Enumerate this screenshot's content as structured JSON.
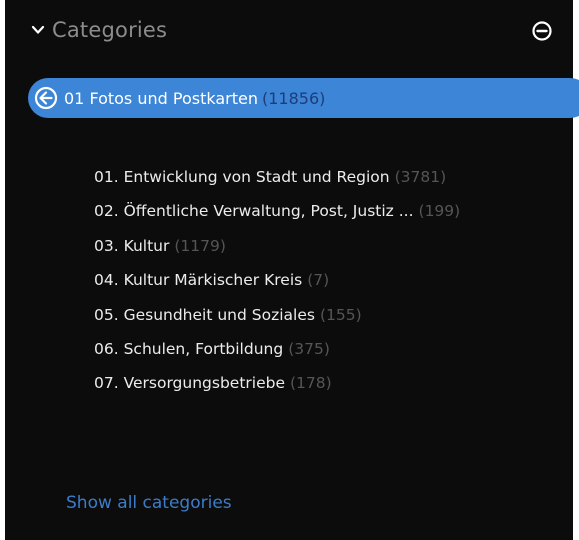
{
  "header": {
    "title": "Categories"
  },
  "selected": {
    "label": "01 Fotos und Postkarten",
    "count": "(11856)"
  },
  "categories": [
    {
      "label": "01. Entwicklung von Stadt und Region",
      "count": "(3781)"
    },
    {
      "label": "02. Öffentliche Verwaltung, Post, Justiz ...",
      "count": "(199)"
    },
    {
      "label": "03. Kultur",
      "count": "(1179)"
    },
    {
      "label": "04. Kultur Märkischer Kreis",
      "count": "(7)"
    },
    {
      "label": "05. Gesundheit und Soziales",
      "count": "(155)"
    },
    {
      "label": "06. Schulen, Fortbildung",
      "count": "(375)"
    },
    {
      "label": "07. Versorgungsbetriebe",
      "count": "(178)"
    }
  ],
  "footer": {
    "show_all": "Show all categories"
  },
  "colors": {
    "panel_bg": "#0c0c0c",
    "accent": "#3d85d6",
    "link": "#3d7cc9",
    "count_muted": "#555555"
  }
}
